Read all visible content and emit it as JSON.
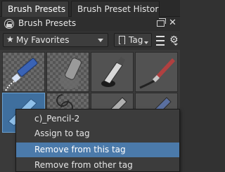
{
  "tabs": [
    {
      "label": "Brush Presets",
      "active": true
    },
    {
      "label": "Brush Preset History",
      "active": false
    }
  ],
  "panel": {
    "title": "Brush Presets",
    "lock_icon": "lock-icon",
    "float_icon": "float-window-icon",
    "close_icon": "close-icon"
  },
  "toolbar": {
    "favorites_label": "My Favorites",
    "favorites_icon": "star-icon",
    "tag_label": "Tag",
    "tag_icon": "tag-icon",
    "menu_icon": "hamburger-menu-icon",
    "settings_icon": "gear-icon"
  },
  "presets": [
    {
      "name": "pen-stroke-preset",
      "selected": false
    },
    {
      "name": "eraser-preset",
      "selected": false
    },
    {
      "name": "ink-pen-preset",
      "selected": false
    },
    {
      "name": "paint-brush-preset",
      "selected": false
    },
    {
      "name": "pencil-preset",
      "selected": true
    },
    {
      "name": "clone-preset",
      "selected": false
    },
    {
      "name": "brush-preset",
      "selected": false
    },
    {
      "name": "brush-preset-2",
      "selected": false
    }
  ],
  "context_menu": {
    "items": [
      {
        "label": "c)_Pencil-2",
        "highlighted": false
      },
      {
        "label": "Assign to tag",
        "highlighted": false
      },
      {
        "label": "Remove from this tag",
        "highlighted": true
      },
      {
        "label": "Remove from other tag",
        "highlighted": false
      }
    ]
  },
  "colors": {
    "selection": "#3f6f9e",
    "highlight": "#4b7aaa",
    "panel_bg": "#323232"
  }
}
